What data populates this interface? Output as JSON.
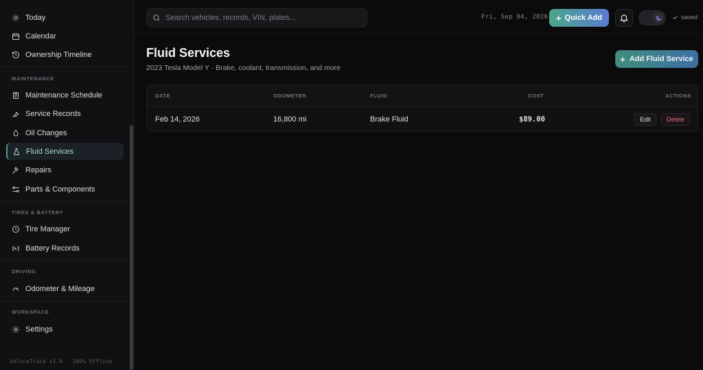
{
  "sidebar": {
    "items_top": [
      {
        "label": "Today",
        "icon": "sun-icon"
      },
      {
        "label": "Calendar",
        "icon": "calendar-icon"
      },
      {
        "label": "Ownership Timeline",
        "icon": "history-icon"
      }
    ],
    "sections": [
      {
        "title": "MAINTENANCE",
        "items": [
          {
            "label": "Maintenance Schedule",
            "icon": "clipboard-icon"
          },
          {
            "label": "Service Records",
            "icon": "wrench-icon"
          },
          {
            "label": "Oil Changes",
            "icon": "droplet-icon"
          },
          {
            "label": "Fluid Services",
            "icon": "flask-icon",
            "active": true
          },
          {
            "label": "Repairs",
            "icon": "hammer-icon"
          },
          {
            "label": "Parts & Components",
            "icon": "parts-icon"
          }
        ]
      },
      {
        "title": "TIRES & BATTERY",
        "items": [
          {
            "label": "Tire Manager",
            "icon": "tire-icon"
          },
          {
            "label": "Battery Records",
            "icon": "battery-icon"
          }
        ]
      },
      {
        "title": "DRIVING",
        "items": [
          {
            "label": "Odometer & Mileage",
            "icon": "gauge-icon"
          }
        ]
      },
      {
        "title": "WORKSPACE",
        "items": [
          {
            "label": "Settings",
            "icon": "gear-icon"
          }
        ]
      }
    ],
    "footer": "VeloceTrack v1.0 · 100% Offline"
  },
  "topbar": {
    "search_placeholder": "Search vehicles, records, VIN, plates...",
    "date": "Fri, Sep 04, 2026",
    "quick_add_label": "Quick Add",
    "saved_label": "saved"
  },
  "page": {
    "title": "Fluid Services",
    "subtitle": "2023 Tesla Model Y · Brake, coolant, transmission, and more",
    "add_button_label": "Add Fluid Service"
  },
  "table": {
    "headers": {
      "date": "DATE",
      "odometer": "ODOMETER",
      "fluid": "FLUID",
      "cost": "COST",
      "actions": "ACTIONS"
    },
    "rows": [
      {
        "date": "Feb 14, 2026",
        "odometer": "16,800 mi",
        "fluid": "Brake Fluid",
        "cost": "$89.00",
        "edit": "Edit",
        "delete": "Delete"
      }
    ]
  },
  "colors": {
    "accent_green": "#3ea67c",
    "accent_blue": "#5b7cd1",
    "danger": "#e36b7a"
  }
}
